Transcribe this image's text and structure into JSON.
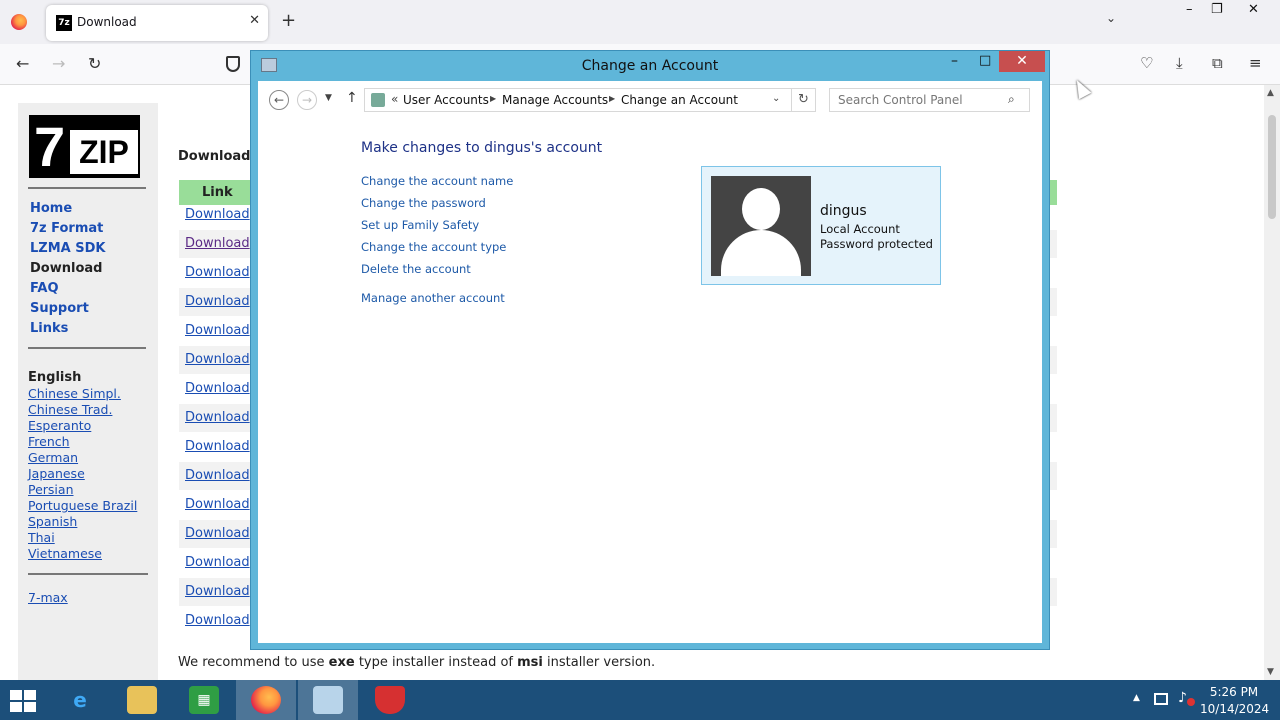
{
  "browser": {
    "tab_title": "Download",
    "tab_favicon": "7z",
    "close_tab": "✕",
    "new_tab": "+",
    "tab_list": "⌄",
    "minimize": "–",
    "restore": "❐",
    "close": "✕",
    "back": "←",
    "forward": "→",
    "reload": "↻",
    "pocket": "♡",
    "downloads": "⤓",
    "extensions": "⧉",
    "menu": "≡"
  },
  "site": {
    "logo_seven": "7",
    "logo_zip": "ZIP",
    "menu": [
      "Home",
      "7z Format",
      "LZMA SDK",
      "Download",
      "FAQ",
      "Support",
      "Links"
    ],
    "current_menu": "Download",
    "language_heading": "English",
    "languages": [
      "Chinese Simpl.",
      "Chinese Trad.",
      "Esperanto",
      "French",
      "German",
      "Japanese",
      "Persian",
      "Portuguese Brazil",
      "Spanish",
      "Thai",
      "Vietnamese"
    ],
    "extra_link": "7-max",
    "download_heading": "Download",
    "table_header": "Link",
    "download_links": [
      "Download",
      "Download",
      "Download",
      "Download",
      "Download",
      "Download",
      "Download",
      "Download",
      "Download",
      "Download",
      "Download",
      "Download",
      "Download",
      "Download",
      "Download"
    ],
    "recommend_pre": "We recommend to use ",
    "recommend_exe": "exe",
    "recommend_mid": " type installer instead of ",
    "recommend_msi": "msi",
    "recommend_post": " installer version."
  },
  "control_panel": {
    "window_title": "Change an Account",
    "minimize": "–",
    "maximize": "□",
    "close": "✕",
    "breadcrumb_chevron": "«",
    "breadcrumb": [
      "User Accounts",
      "Manage Accounts",
      "Change an Account"
    ],
    "search_placeholder": "Search Control Panel",
    "heading": "Make changes to dingus's account",
    "links": [
      "Change the account name",
      "Change the password",
      "Set up Family Safety",
      "Change the account type",
      "Delete the account"
    ],
    "manage_another": "Manage another account",
    "account": {
      "name": "dingus",
      "type": "Local Account",
      "status": "Password protected"
    }
  },
  "taskbar": {
    "time": "5:26 PM",
    "date": "10/14/2024",
    "apps": [
      "internet-explorer",
      "file-explorer",
      "store",
      "firefox",
      "control-panel",
      "security-shield"
    ]
  },
  "colors": {
    "accent_window": "#5fb6d9",
    "table_header": "#99dd99",
    "link": "#1a4db3",
    "taskbar": "#1c4f7a"
  }
}
